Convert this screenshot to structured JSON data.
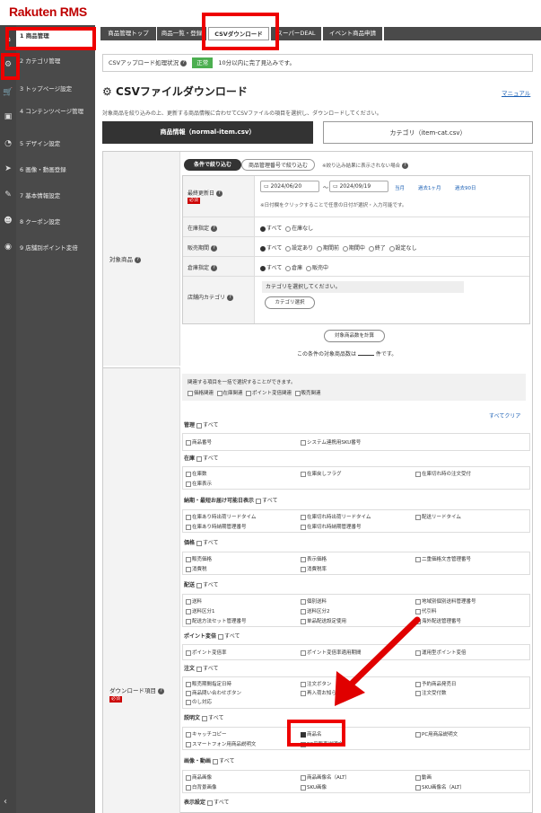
{
  "app": {
    "logo": "Rakuten RMS"
  },
  "sidebar": {
    "items": [
      {
        "label": "1 商品管理",
        "icon": "tag-icon"
      },
      {
        "label": "2 カテゴリ管理",
        "icon": "gear-icon"
      },
      {
        "label": "3 トップページ設定",
        "icon": "cart-icon"
      },
      {
        "label": "4 コンテンツページ管理",
        "icon": "pages-icon"
      },
      {
        "label": "5 デザイン設定",
        "icon": "pie-icon"
      },
      {
        "label": "6 画像・動画登録",
        "icon": "send-icon"
      },
      {
        "label": "7 基本情報設定",
        "icon": "wrench-icon"
      },
      {
        "label": "8 クーポン設定",
        "icon": "people-icon"
      },
      {
        "label": "9 店舗別ポイント変倍",
        "icon": "point-icon"
      }
    ],
    "collapse": "‹"
  },
  "tabs": [
    "商品管理トップ",
    "商品一覧・登録",
    "CSVダウンロード",
    "スーパーDEAL",
    "イベント商品申請"
  ],
  "status": {
    "label": "CSVアップロード処理状況",
    "icon": "help-icon",
    "badge": "正常",
    "text": "10分以内に完了見込みです。"
  },
  "page": {
    "title": "CSVファイルダウンロード",
    "manual": "マニュアル",
    "desc": "対象商品を絞り込みの上、更新する商品情報に合わせてCSVファイルの項目を選択し、ダウンロードしてください。"
  },
  "subtabs": [
    "商品情報（normal-item.csv）",
    "カテゴリ（item-cat.csv）"
  ],
  "target": {
    "label": "対象商品",
    "filter_tabs": [
      "条件で絞り込む",
      "商品管理番号で絞り込む"
    ],
    "filter_note": "※絞り込み結果に表示されない場合",
    "rows": {
      "updated": {
        "label": "最終更新日",
        "required": "必須",
        "from": "2024/06/20",
        "sep": "〜",
        "to": "2024/09/19",
        "links": [
          "当月",
          "過去1ヶ月",
          "過去90日"
        ],
        "note": "※日付欄をクリックすることで任意の日付が選択・入力可能です。"
      },
      "stock": {
        "label": "在庫指定",
        "options": [
          "すべて",
          "在庫なし"
        ]
      },
      "sale": {
        "label": "販売期間",
        "options": [
          "すべて",
          "設定あり",
          "期間前",
          "期間中",
          "終了",
          "設定なし"
        ]
      },
      "warehouse": {
        "label": "倉庫指定",
        "options": [
          "すべて",
          "倉庫",
          "販売中"
        ]
      },
      "category": {
        "label": "店舗内カテゴリ",
        "placeholder": "カテゴリを選択してください。",
        "button": "カテゴリ選択"
      }
    },
    "count_button": "対象商品数を計算",
    "count_pre": "この条件の対象商品数は",
    "count_post": "件です。"
  },
  "download": {
    "label": "ダウンロード項目",
    "required": "必須",
    "group_text": "関連する項目を一括で選択することができます。",
    "groups": [
      "価格関連",
      "在庫関連",
      "ポイント変倍関連",
      "販売関連"
    ],
    "clear_all": "すべてクリア",
    "all_label": "すべて",
    "sections": [
      {
        "title": "管理",
        "items": [
          "商品番号",
          "システム連携用SKU番号"
        ]
      },
      {
        "title": "在庫",
        "items": [
          "在庫数",
          "在庫戻しフラグ",
          "在庫切れ時の注文受付",
          "在庫表示"
        ]
      },
      {
        "title": "納期・最短お届け可能日表示",
        "items": [
          "在庫あり時出荷リードタイム",
          "在庫切れ時出荷リードタイム",
          "配送リードタイム",
          "在庫あり時納期管理番号",
          "在庫切れ時納期管理番号"
        ]
      },
      {
        "title": "価格",
        "items": [
          "販売価格",
          "表示価格",
          "二重価格文言管理番号",
          "消費税",
          "消費税率"
        ]
      },
      {
        "title": "配送",
        "items": [
          "送料",
          "個別送料",
          "地域別個別送料管理番号",
          "送料区分1",
          "送料区分2",
          "代引料",
          "配送方法セット管理番号",
          "单品配送設定使用",
          "海外配送管理番号"
        ]
      },
      {
        "title": "ポイント変倍",
        "items": [
          "ポイント変倍率",
          "ポイント変倍率適用期間",
          "運用型ポイント変倍"
        ]
      },
      {
        "title": "注文",
        "items": [
          "販売期間指定日時",
          "注文ボタン",
          "予約商品発売日",
          "商品問い合わせボタン",
          "再入荷お知らせボタン",
          "注文受付数",
          "のし対応"
        ]
      },
      {
        "title": "説明文",
        "items": [
          "キャッチコピー",
          "商品名",
          "PC用商品説明文",
          "スマートフォン用商品説明文",
          "PC用販売説明文"
        ]
      },
      {
        "title": "画像・動画",
        "items": [
          "商品画像",
          "商品画像名（ALT）",
          "動画",
          "白背景画像",
          "SKU画像",
          "SKU画像名（ALT）"
        ]
      },
      {
        "title": "表示設定",
        "items": []
      }
    ]
  },
  "checked": [
    "すべて",
    "商品名"
  ],
  "colors": {
    "accent": "#bf0000",
    "highlight": "#e00000",
    "sidebar_bg": "#4a4a4a",
    "badge": "#4caf50"
  }
}
